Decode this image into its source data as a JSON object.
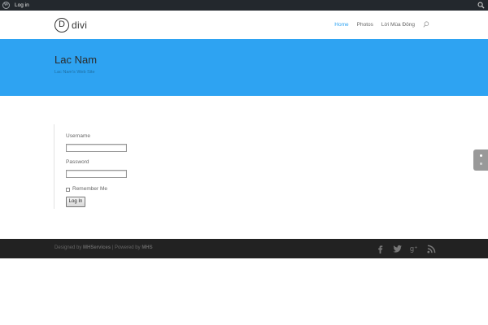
{
  "admin_bar": {
    "login_label": "Log in"
  },
  "header": {
    "logo_letter": "D",
    "logo_text": "divi",
    "nav": [
      {
        "label": "Home",
        "active": true
      },
      {
        "label": "Photos",
        "active": false
      },
      {
        "label": "Lời Mùa Đông",
        "active": false
      }
    ]
  },
  "hero": {
    "title": "Lac Nam",
    "tagline": "Lac Nam's Web Site"
  },
  "login": {
    "username_label": "Username",
    "username_value": "",
    "password_label": "Password",
    "password_value": "",
    "remember_label": "Remember Me",
    "submit_label": "Log In"
  },
  "footer": {
    "designed_prefix": "Designed by ",
    "designer": "MHServices",
    "separator": " | Powered by ",
    "powered": "MHS",
    "social_icons": [
      "facebook-icon",
      "twitter-icon",
      "google-plus-icon",
      "rss-icon"
    ]
  },
  "colors": {
    "accent": "#2ea3f2",
    "admin_bar": "#23282d",
    "footer": "#222222"
  }
}
